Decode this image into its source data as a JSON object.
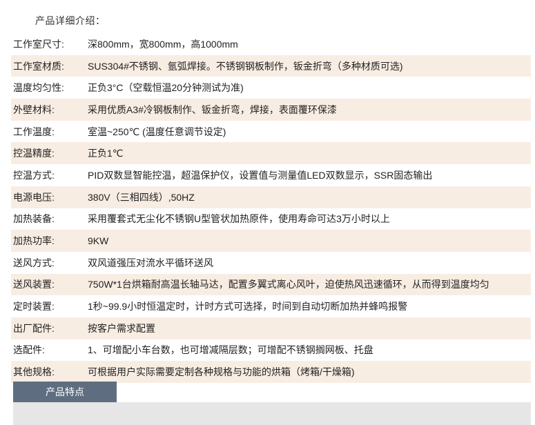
{
  "section_title": "产品详细介绍：",
  "specs": [
    {
      "label": "工作室尺寸:",
      "value": "深800mm，宽800mm，高1000mm"
    },
    {
      "label": "工作室材质:",
      "value": "SUS304#不锈钢、氩弧焊接。不锈钢钢板制作，钣金折弯（多种材质可选)"
    },
    {
      "label": "温度均匀性:",
      "value": " 正负3°C（空载恒温20分钟测试为准)"
    },
    {
      "label": "外壁材料:",
      "value": "采用优质A3#冷钢板制作、钣金折弯，焊接，表面覆环保漆"
    },
    {
      "label": "工作温度:",
      "value": "室温~250℃  (温度任意调节设定)"
    },
    {
      "label": "控温精度:",
      "value": "正负1℃"
    },
    {
      "label": "控温方式:",
      "value": "PID双数显智能控温，超温保护仪，设置值与测量值LED双数显示，SSR固态输出"
    },
    {
      "label": "电源电压:",
      "value": "380V（三相四线）,50HZ"
    },
    {
      "label": "加热装备:",
      "value": "采用覆套式无尘化不锈钢U型管状加热原件，使用寿命可达3万小时以上"
    },
    {
      "label": "加热功率:",
      "value": "9KW"
    },
    {
      "label": "送风方式:",
      "value": "双风道强压对流水平循环送风"
    },
    {
      "label": "送风装置:",
      "value": "750W*1台烘箱耐高温长轴马达，配置多翼式离心风叶，迫使热风迅速循环，从而得到温度均匀"
    },
    {
      "label": "定时装置:",
      "value": " 1秒~99.9小时恒温定时，计时方式可选择，时间到自动切断加热并蜂鸣报警"
    },
    {
      "label": "出厂配件:",
      "value": "按客户需求配置"
    },
    {
      "label": "选配件:",
      "value": "1、可增配小车台数，也可增减隔层数；可增配不锈钢搁网板、托盘"
    },
    {
      "label": "其他规格:",
      "value": "可根据用户实际需要定制各种规格与功能的烘箱（烤箱/干燥箱)"
    }
  ],
  "tabs": {
    "active_label": "产品特点"
  },
  "colors": {
    "row_shade": "#f8ede3",
    "tab_active_bg": "#5e6e80",
    "content_bg": "#e6e6e6"
  }
}
